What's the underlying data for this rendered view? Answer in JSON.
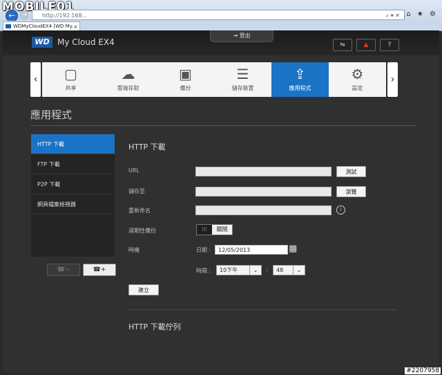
{
  "browser": {
    "logo": "MOBILE01",
    "logo_sub": "",
    "address": "http://192.168...",
    "tab_label": "WDMyCloudEX4 [WD My...",
    "tab_close": "×",
    "back": "←",
    "forward": "→",
    "right_icons": "⌂ ★ ⚙"
  },
  "header": {
    "logout": "登出",
    "brand": "WD",
    "product": "My Cloud EX4",
    "usb_icon": "usb-icon",
    "alert_icon": "bell-icon",
    "help": "?"
  },
  "nav": {
    "prev": "‹",
    "next": "›",
    "items": [
      {
        "label": "共享",
        "icon": "folder-icon",
        "glyph": "▢"
      },
      {
        "label": "雲端存取",
        "icon": "cloud-icon",
        "glyph": "☁"
      },
      {
        "label": "備份",
        "icon": "safe-icon",
        "glyph": "▣"
      },
      {
        "label": "儲存裝置",
        "icon": "storage-icon",
        "glyph": "☰"
      },
      {
        "label": "應用程式",
        "icon": "apps-icon",
        "glyph": "⇪"
      },
      {
        "label": "設定",
        "icon": "gear-icon",
        "glyph": "⚙"
      }
    ],
    "active_index": 4
  },
  "page_title": "應用程式",
  "sidebar": {
    "items": [
      "HTTP 下載",
      "FTP 下載",
      "P2P 下載",
      "網頁檔案檢視器"
    ],
    "active_index": 0,
    "remove_button": "☎−",
    "add_button": "☎+"
  },
  "form": {
    "section_title": "HTTP 下載",
    "url_label": "URL",
    "test_button": "測試",
    "save_to_label": "儲存至",
    "browse_button": "瀏覽",
    "rename_label": "重新命名",
    "info_icon": "i",
    "periodic_label": "週期性備份",
    "toggle_knob": "III",
    "toggle_state": "關閉",
    "timing_label": "時機",
    "date_label": "日期 :",
    "date_value": "12/05/2013",
    "time_label": "時間 :",
    "hour_value": "10下午",
    "colon": ":",
    "minute_value": "48",
    "create_button": "建立",
    "queue_title": "HTTP 下載佇列"
  },
  "watermark": "#2207958"
}
